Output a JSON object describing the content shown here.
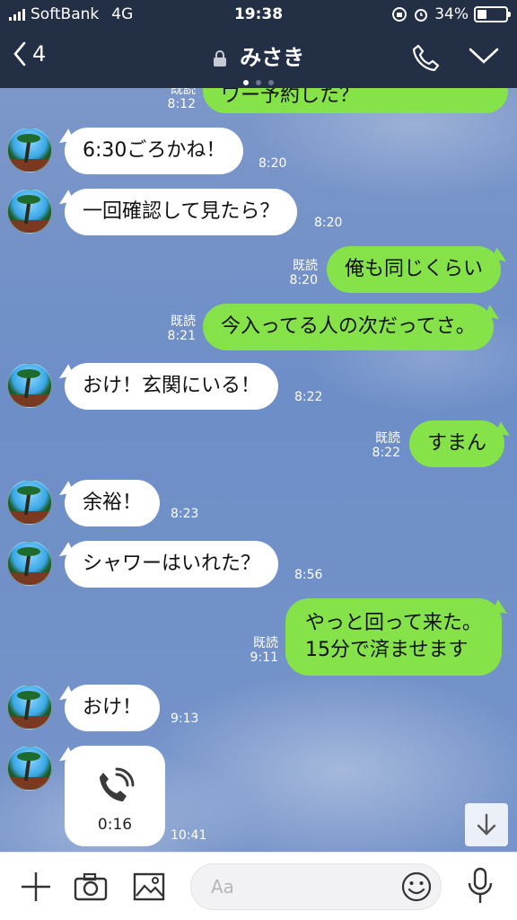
{
  "status_bar": {
    "carrier": "SoftBank",
    "network": "4G",
    "time": "19:38",
    "battery_percent": "34%",
    "battery_level": 0.34
  },
  "header": {
    "back_count": "4",
    "title": "みさき",
    "pager_dots": 3,
    "active_dot": 0
  },
  "chat": {
    "top_partial": {
      "read": "既読",
      "time": "8:12",
      "text": "ワー予約した？"
    },
    "messages": [
      {
        "from": "other",
        "text": "6:30ごろかね！",
        "time": "8:20"
      },
      {
        "from": "other",
        "text": "一回確認して見たら？",
        "time": "8:20"
      },
      {
        "from": "me",
        "text": "俺も同じくらい",
        "read": "既読",
        "time": "8:20"
      },
      {
        "from": "me",
        "text": "今入ってる人の次だってさ。",
        "read": "既読",
        "time": "8:21"
      },
      {
        "from": "other",
        "text": "おけ！玄関にいる！",
        "time": "8:22"
      },
      {
        "from": "me",
        "text": "すまん",
        "read": "既読",
        "time": "8:22"
      },
      {
        "from": "other",
        "text": "余裕！",
        "time": "8:23"
      },
      {
        "from": "other",
        "text": "シャワーはいれた？",
        "time": "8:56"
      },
      {
        "from": "me",
        "text_line1": "やっと回って来た。",
        "text_line2": "15分で済ませます",
        "read": "既読",
        "time": "9:11"
      },
      {
        "from": "other",
        "text": "おけ！",
        "time": "9:13"
      },
      {
        "from": "other",
        "type": "call",
        "duration": "0:16",
        "time": "10:41"
      }
    ]
  },
  "input_bar": {
    "placeholder": "Aa"
  },
  "colors": {
    "header_bg": "#232f45",
    "my_bubble": "#85e249",
    "their_bubble": "#ffffff",
    "chat_bg": "#7391c9"
  },
  "icons": [
    "back-chevron-icon",
    "lock-icon",
    "phone-icon",
    "chevron-down-icon",
    "plus-icon",
    "camera-icon",
    "image-icon",
    "emoji-icon",
    "microphone-icon",
    "arrow-down-icon",
    "call-icon"
  ]
}
